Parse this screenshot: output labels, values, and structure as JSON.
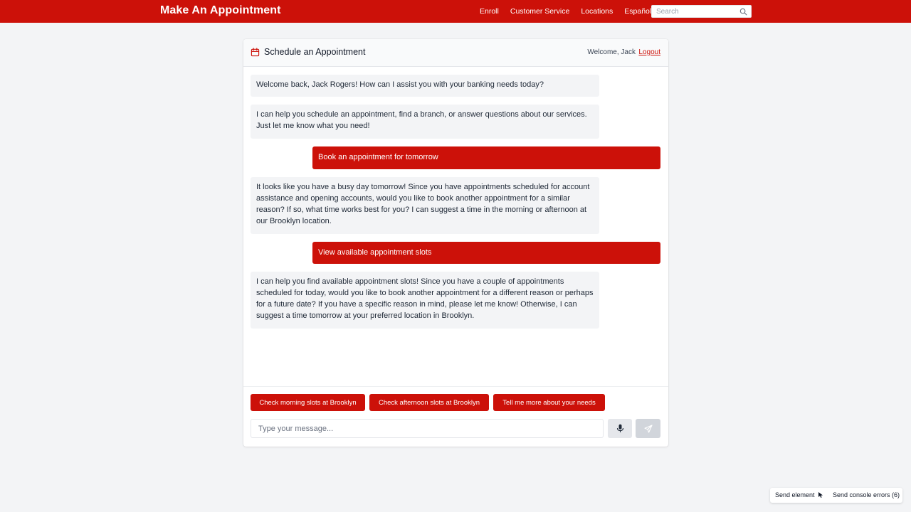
{
  "app": {
    "brand": "Make An Appointment",
    "nav": [
      {
        "label": "Enroll"
      },
      {
        "label": "Customer Service"
      },
      {
        "label": "Locations"
      },
      {
        "label": "Español"
      }
    ],
    "search": {
      "placeholder": "Search"
    }
  },
  "chat": {
    "title": "Schedule an Appointment",
    "welcome": "Welcome, Jack",
    "logout": "Logout",
    "messages": [
      {
        "role": "bot",
        "text": "Welcome back, Jack Rogers! How can I assist you with your banking needs today?"
      },
      {
        "role": "bot",
        "text": "I can help you schedule an appointment, find a branch, or answer questions about our services. Just let me know what you need!"
      },
      {
        "role": "user",
        "text": "Book an appointment for tomorrow"
      },
      {
        "role": "bot",
        "text": "It looks like you have a busy day tomorrow! Since you have appointments scheduled for account assistance and opening accounts, would you like to book another appointment for a similar reason? If so, what time works best for you? I can suggest a time in the morning or afternoon at our Brooklyn location."
      },
      {
        "role": "user",
        "text": "View available appointment slots"
      },
      {
        "role": "bot",
        "text": "I can help you find available appointment slots! Since you have a couple of appointments scheduled for today, would you like to book another appointment for a different reason or perhaps for a future date? If you have a specific reason in mind, please let me know! Otherwise, I can suggest a time tomorrow at your preferred location in Brooklyn."
      }
    ],
    "suggestions": [
      {
        "label": "Check morning slots at Brooklyn"
      },
      {
        "label": "Check afternoon slots at Brooklyn"
      },
      {
        "label": "Tell me more about your needs"
      }
    ],
    "input": {
      "placeholder": "Type your message..."
    }
  },
  "devtools": {
    "send_element": "Send element",
    "send_console_errors": "Send console errors (6)"
  },
  "colors": {
    "brand_red": "#cc1109",
    "background": "#f3f4f6",
    "bot_bubble": "#f3f4f6"
  }
}
